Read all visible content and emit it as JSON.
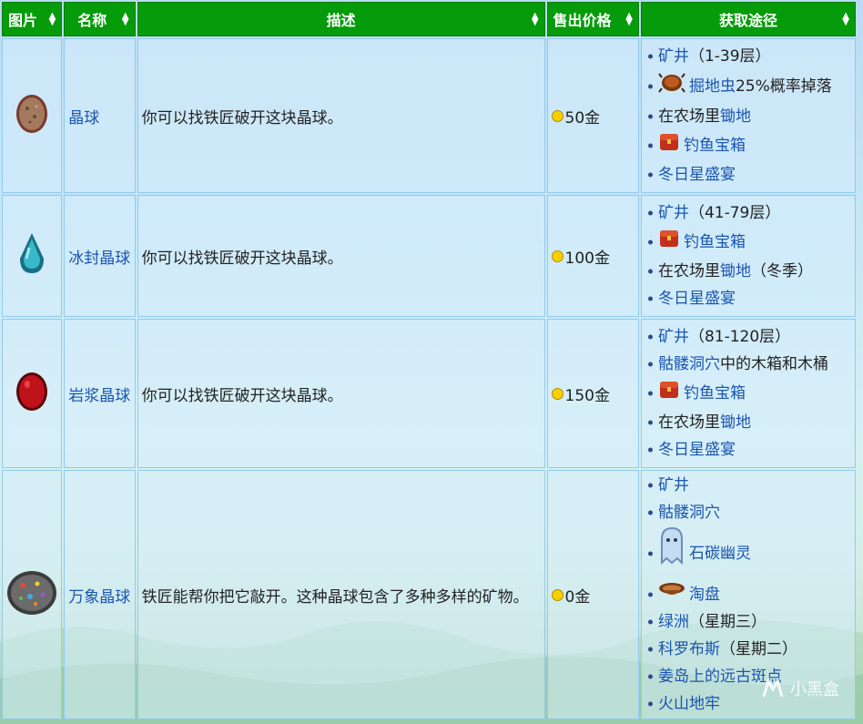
{
  "headers": {
    "image": "图片",
    "name": "名称",
    "description": "描述",
    "sell_price": "售出价格",
    "source": "获取途径"
  },
  "rows": [
    {
      "icon": "geode-icon",
      "name": "晶球",
      "description": "你可以找铁匠破开这块晶球。",
      "price": "50金",
      "sources": [
        {
          "text": "矿井",
          "suffix": "（1-39层）"
        },
        {
          "icon": "bug-icon",
          "text": "掘地虫",
          "suffix": "25%概率掉落"
        },
        {
          "text": "在农场里",
          "suffix_link": "锄地"
        },
        {
          "icon": "treasure-chest-icon",
          "text": "钓鱼宝箱"
        },
        {
          "text": "冬日星盛宴"
        }
      ]
    },
    {
      "icon": "frozen-geode-icon",
      "name": "冰封晶球",
      "description": "你可以找铁匠破开这块晶球。",
      "price": "100金",
      "sources": [
        {
          "text": "矿井",
          "suffix": "（41-79层）"
        },
        {
          "icon": "treasure-chest-icon",
          "text": "钓鱼宝箱"
        },
        {
          "text": "在农场里",
          "suffix_link": "锄地",
          "suffix": "（冬季）"
        },
        {
          "text": "冬日星盛宴"
        }
      ]
    },
    {
      "icon": "magma-geode-icon",
      "name": "岩浆晶球",
      "description": "你可以找铁匠破开这块晶球。",
      "price": "150金",
      "sources": [
        {
          "text": "矿井",
          "suffix": "（81-120层）"
        },
        {
          "text": "骷髅洞穴",
          "suffix": "中的木箱和木桶"
        },
        {
          "icon": "treasure-chest-icon",
          "text": "钓鱼宝箱"
        },
        {
          "text": "在农场里",
          "suffix_link": "锄地"
        },
        {
          "text": "冬日星盛宴"
        }
      ]
    },
    {
      "icon": "omni-geode-icon",
      "name": "万象晶球",
      "description": "铁匠能帮你把它敲开。这种晶球包含了多种多样的矿物。",
      "price": "0金",
      "sources": [
        {
          "text": "矿井"
        },
        {
          "text": "骷髅洞穴"
        },
        {
          "icon": "ghost-icon",
          "text": "石碳幽灵"
        },
        {
          "icon": "pan-icon",
          "text": "淘盘"
        },
        {
          "text": "绿洲",
          "suffix": "（星期三）"
        },
        {
          "text": "科罗布斯",
          "suffix": "（星期二）"
        },
        {
          "text": "姜岛上的远古斑点"
        },
        {
          "text": "火山地牢"
        }
      ]
    }
  ],
  "watermark": "小黑盒",
  "colors": {
    "header_bg": "#069b0a",
    "link": "#1a55b0",
    "cell_border": "#8fcbf0"
  }
}
